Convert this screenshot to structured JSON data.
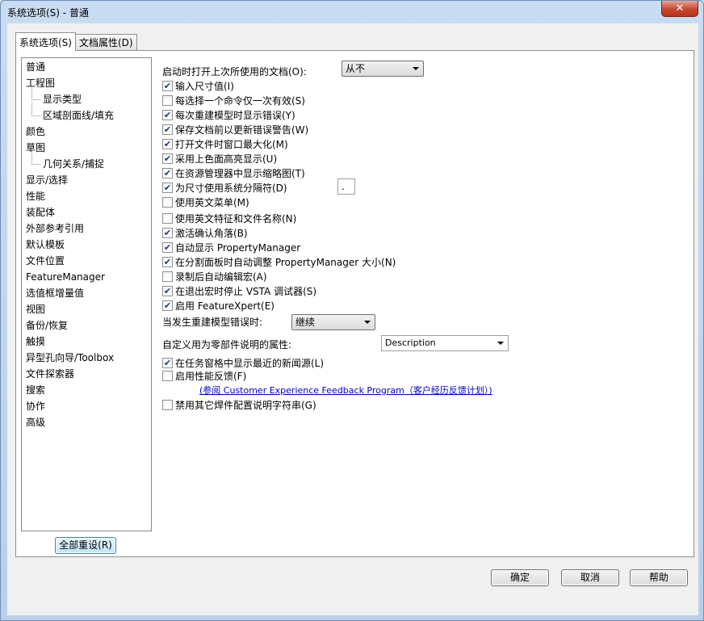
{
  "window": {
    "title": "系统选项(S) - 普通",
    "close_glyph": "✕"
  },
  "tabs": [
    {
      "label": "系统选项(S)"
    },
    {
      "label": "文档属性(D)"
    }
  ],
  "tree": [
    {
      "label": "普通"
    },
    {
      "label": "工程图"
    },
    {
      "label": "显示类型"
    },
    {
      "label": "区域剖面线/填充"
    },
    {
      "label": "颜色"
    },
    {
      "label": "草图"
    },
    {
      "label": "几何关系/捕捉"
    },
    {
      "label": "显示/选择"
    },
    {
      "label": "性能"
    },
    {
      "label": "装配体"
    },
    {
      "label": "外部参考引用"
    },
    {
      "label": "默认模板"
    },
    {
      "label": "文件位置"
    },
    {
      "label": "FeatureManager"
    },
    {
      "label": "选值框增量值"
    },
    {
      "label": "视图"
    },
    {
      "label": "备份/恢复"
    },
    {
      "label": "触摸"
    },
    {
      "label": "异型孔向导/Toolbox"
    },
    {
      "label": "文件探索器"
    },
    {
      "label": "搜索"
    },
    {
      "label": "协作"
    },
    {
      "label": "高级"
    }
  ],
  "reset_button": "全部重设(R)",
  "open_last_docs": {
    "label": "启动时打开上次所使用的文档(O):",
    "value": "从不"
  },
  "options": [
    {
      "label": "输入尺寸值(I)",
      "checked": true
    },
    {
      "label": "每选择一个命令仅一次有效(S)",
      "checked": false
    },
    {
      "label": "每次重建模型时显示错误(Y)",
      "checked": true
    },
    {
      "label": "保存文档前以更新错误警告(W)",
      "checked": true
    },
    {
      "label": "打开文件时窗口最大化(M)",
      "checked": true
    },
    {
      "label": "采用上色面高亮显示(U)",
      "checked": true
    },
    {
      "label": "在资源管理器中显示缩略图(T)",
      "checked": true
    },
    {
      "label": "为尺寸使用系统分隔符(D)",
      "checked": true
    },
    {
      "label": "使用英文菜单(M)",
      "checked": false
    },
    {
      "label": "使用英文特征和文件名称(N)",
      "checked": false
    },
    {
      "label": "激活确认角落(B)",
      "checked": true
    },
    {
      "label": "自动显示 PropertyManager",
      "checked": true
    },
    {
      "label": "在分割面板时自动调整 PropertyManager 大小(N)",
      "checked": true
    },
    {
      "label": "录制后自动编辑宏(A)",
      "checked": false
    },
    {
      "label": "在退出宏时停止 VSTA 调试器(S)",
      "checked": true
    },
    {
      "label": "启用 FeatureXpert(E)",
      "checked": true
    }
  ],
  "separator_value": ".",
  "rebuild_error": {
    "label": "当发生重建模型错误时:",
    "value": "继续"
  },
  "custom_property": {
    "label": "自定义用为零部件说明的属性:",
    "value": "Description"
  },
  "options2": [
    {
      "label": "在任务窗格中显示最近的新闻源(L)",
      "checked": true
    },
    {
      "label": "启用性能反馈(F)",
      "checked": false
    }
  ],
  "feedback_link": "(参阅 Customer Experience Feedback Program（客户经历反馈计划）)",
  "options3": [
    {
      "label": "禁用其它焊件配置说明字符串(G)",
      "checked": false
    }
  ],
  "buttons": {
    "ok": "确定",
    "cancel": "取消",
    "help": "帮助"
  },
  "check_glyph": "✔"
}
